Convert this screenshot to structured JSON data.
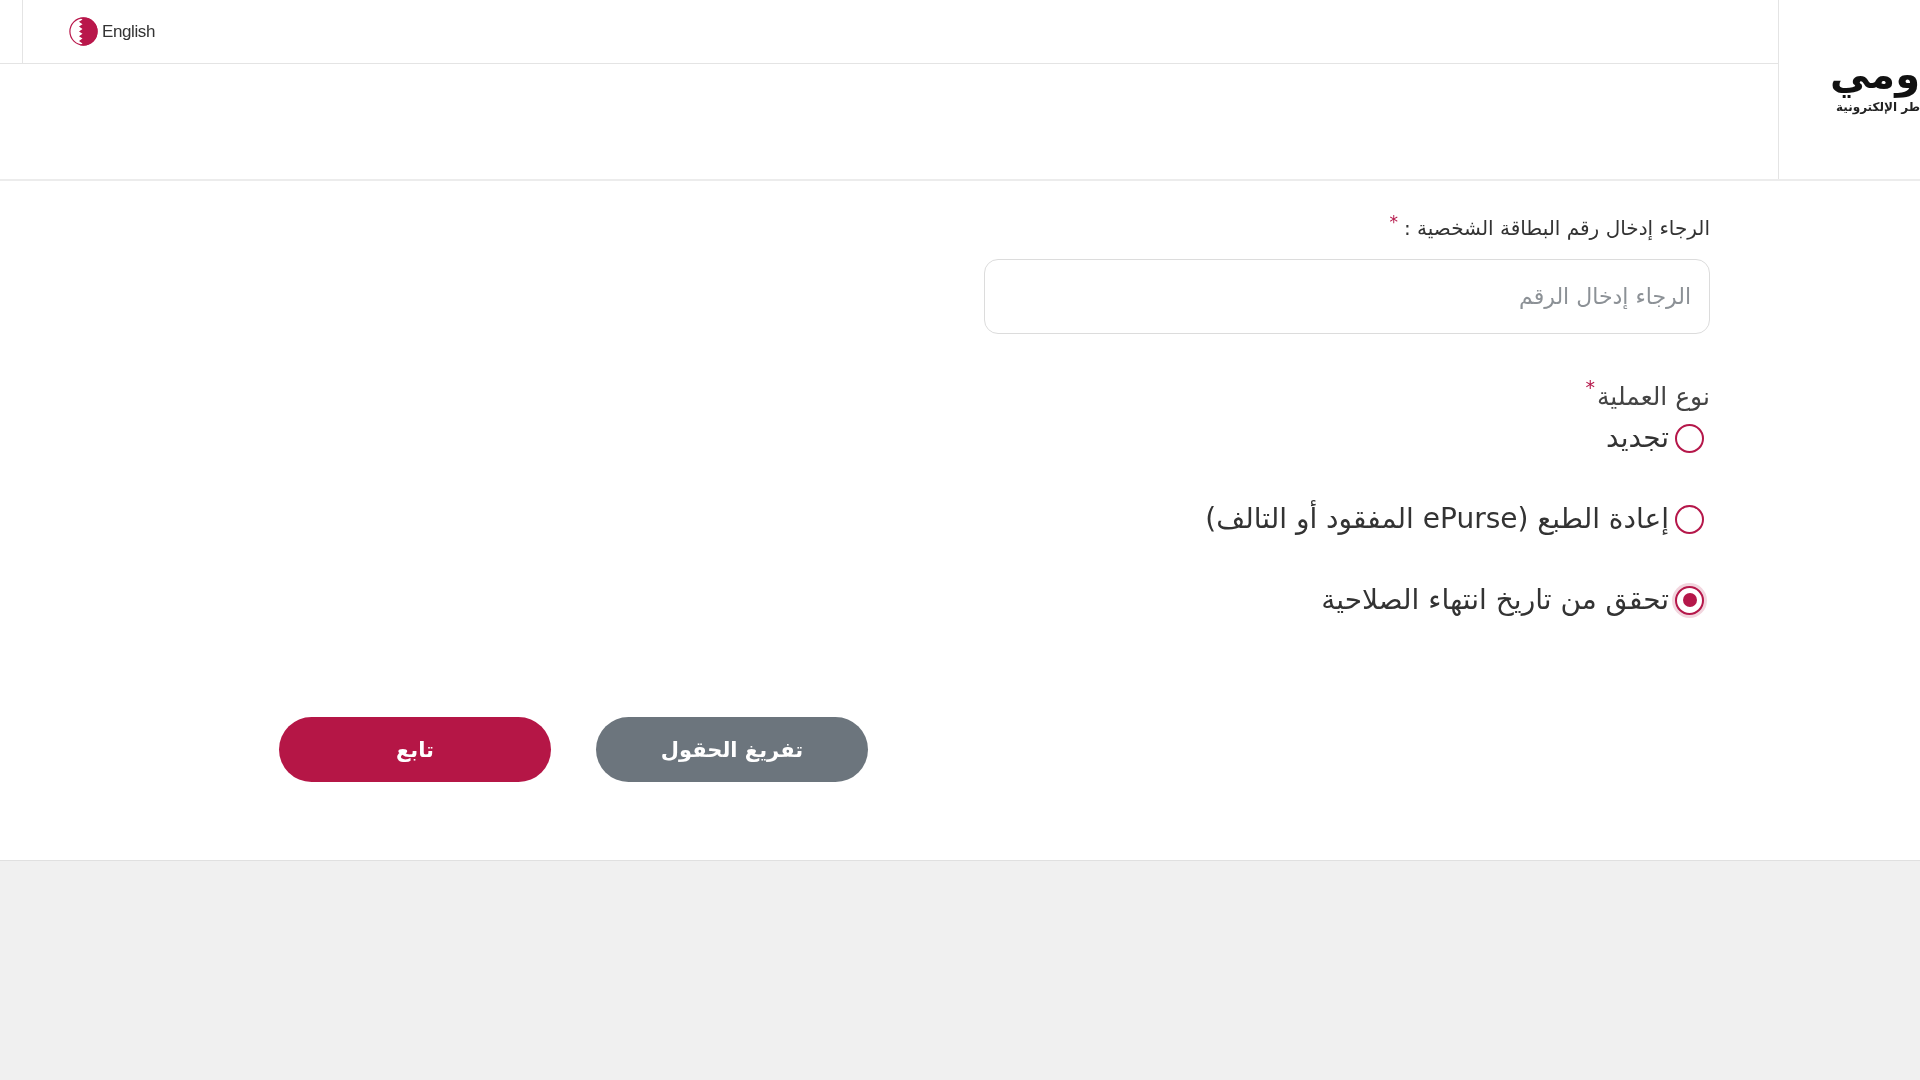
{
  "header": {
    "language_link": "English",
    "logo": {
      "wordmark": "ومي",
      "tagline": "طر الإلكترونية"
    }
  },
  "form": {
    "id_field": {
      "label": "الرجاء إدخال رقم البطاقة الشخصية :",
      "required_mark": "*",
      "placeholder": "الرجاء إدخال الرقم"
    },
    "operation_type": {
      "label": "نوع العملية",
      "required_mark": "*",
      "options": [
        {
          "label": "تجديد",
          "selected": false
        },
        {
          "label": "إعادة الطبع (ePurse المفقود أو التالف)",
          "selected": false
        },
        {
          "label": "تحقق من تاريخ انتهاء الصلاحية",
          "selected": true
        }
      ]
    },
    "buttons": [
      {
        "label": "تفريغ الحقول",
        "kind": "secondary"
      },
      {
        "label": "تابع",
        "kind": "primary"
      }
    ]
  }
}
